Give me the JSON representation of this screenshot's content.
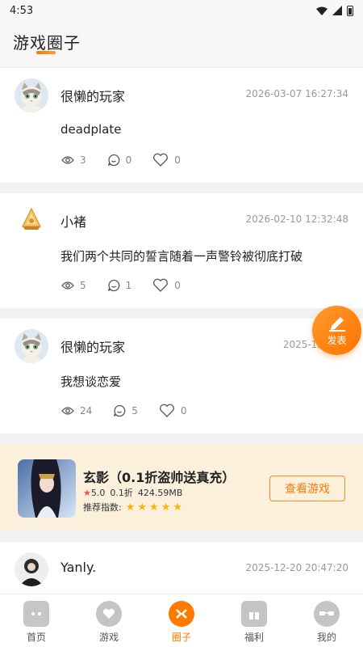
{
  "status_bar": {
    "time": "4:53"
  },
  "header": {
    "title": "游戏圈子"
  },
  "posts": [
    {
      "username": "很懒的玩家",
      "time": "2026-03-07 16:27:34",
      "text": "deadplate",
      "views": "3",
      "comments": "0",
      "likes": "0"
    },
    {
      "username": "小褚",
      "time": "2026-02-10 12:32:48",
      "text": "我们两个共同的誓言随着一声警铃被彻底打破",
      "views": "5",
      "comments": "1",
      "likes": "0"
    },
    {
      "username": "很懒的玩家",
      "time": "2025-12-21 2",
      "text": "我想谈恋爱",
      "views": "24",
      "comments": "5",
      "likes": "0"
    },
    {
      "username": "Yanly.",
      "time": "2025-12-20 20:47:20"
    }
  ],
  "game_card": {
    "title": "玄影（0.1折盗帅送真充）",
    "rating": "5.0",
    "discount": "0.1折",
    "size": "424.59MB",
    "recommend_label": "推荐指数:",
    "recommend_stars": 5,
    "button": "查看游戏"
  },
  "fab": {
    "label": "发表"
  },
  "tabs": [
    {
      "label": "首页",
      "icon": "gamepad-icon",
      "active": false
    },
    {
      "label": "游戏",
      "icon": "heart-chat-icon",
      "active": false
    },
    {
      "label": "圈子",
      "icon": "circle-icon",
      "active": true
    },
    {
      "label": "福利",
      "icon": "gift-icon",
      "active": false
    },
    {
      "label": "我的",
      "icon": "sunglasses-icon",
      "active": false
    }
  ],
  "colors": {
    "accent": "#ff7a00",
    "card_bg": "#fbf0dc",
    "muted": "#999999"
  }
}
